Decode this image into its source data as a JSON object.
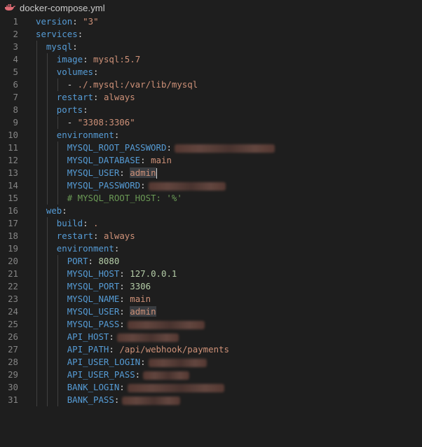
{
  "tab": {
    "title": "docker-compose.yml",
    "icon": "docker-whale-icon",
    "icon_color": "#e06c75"
  },
  "colors": {
    "background": "#1e1e1e",
    "line_number": "#858585",
    "key": "#569cd6",
    "string": "#ce9178",
    "number": "#b5cea8",
    "comment": "#6a9955"
  },
  "lines": [
    {
      "n": "1",
      "indent": 0,
      "key": "version",
      "value": "\"3\"",
      "vtype": "s"
    },
    {
      "n": "2",
      "indent": 0,
      "key": "services",
      "value": "",
      "vtype": ""
    },
    {
      "n": "3",
      "indent": 1,
      "key": "mysql",
      "value": "",
      "vtype": ""
    },
    {
      "n": "4",
      "indent": 2,
      "key": "image",
      "value": "mysql:5.7",
      "vtype": "s"
    },
    {
      "n": "5",
      "indent": 2,
      "key": "volumes",
      "value": "",
      "vtype": ""
    },
    {
      "n": "6",
      "indent": 3,
      "dash": true,
      "value": "./.mysql:/var/lib/mysql",
      "vtype": "s"
    },
    {
      "n": "7",
      "indent": 2,
      "key": "restart",
      "value": "always",
      "vtype": "s"
    },
    {
      "n": "8",
      "indent": 2,
      "key": "ports",
      "value": "",
      "vtype": ""
    },
    {
      "n": "9",
      "indent": 3,
      "dash": true,
      "value": "\"3308:3306\"",
      "vtype": "s"
    },
    {
      "n": "10",
      "indent": 2,
      "key": "environment",
      "value": "",
      "vtype": ""
    },
    {
      "n": "11",
      "indent": 3,
      "key": "MYSQL_ROOT_PASSWORD",
      "value": "",
      "vtype": "",
      "redacted": 0.26
    },
    {
      "n": "12",
      "indent": 3,
      "key": "MYSQL_DATABASE",
      "value": "main",
      "vtype": "s"
    },
    {
      "n": "13",
      "indent": 3,
      "key": "MYSQL_USER",
      "value": "admin",
      "vtype": "s",
      "selected": true,
      "cursor": true
    },
    {
      "n": "14",
      "indent": 3,
      "key": "MYSQL_PASSWORD",
      "value": "",
      "vtype": "",
      "redacted": 0.2
    },
    {
      "n": "15",
      "indent": 3,
      "comment": "# MYSQL_ROOT_HOST: '%'"
    },
    {
      "n": "16",
      "indent": 1,
      "key": "web",
      "value": "",
      "vtype": ""
    },
    {
      "n": "17",
      "indent": 2,
      "key": "build",
      "value": ".",
      "vtype": "s"
    },
    {
      "n": "18",
      "indent": 2,
      "key": "restart",
      "value": "always",
      "vtype": "s"
    },
    {
      "n": "19",
      "indent": 2,
      "key": "environment",
      "value": "",
      "vtype": ""
    },
    {
      "n": "20",
      "indent": 3,
      "key": "PORT",
      "value": "8080",
      "vtype": "n"
    },
    {
      "n": "21",
      "indent": 3,
      "key": "MYSQL_HOST",
      "value": "127.0.0.1",
      "vtype": "n"
    },
    {
      "n": "22",
      "indent": 3,
      "key": "MYSQL_PORT",
      "value": "3306",
      "vtype": "n"
    },
    {
      "n": "23",
      "indent": 3,
      "key": "MYSQL_NAME",
      "value": "main",
      "vtype": "s"
    },
    {
      "n": "24",
      "indent": 3,
      "key": "MYSQL_USER",
      "value": "admin",
      "vtype": "s",
      "selected": true
    },
    {
      "n": "25",
      "indent": 3,
      "key": "MYSQL_PASS",
      "value": "",
      "vtype": "",
      "redacted": 0.2
    },
    {
      "n": "26",
      "indent": 3,
      "key": "API_HOST",
      "value": "",
      "vtype": "",
      "redacted": 0.16
    },
    {
      "n": "27",
      "indent": 3,
      "key": "API_PATH",
      "value": "/api/webhook/payments",
      "vtype": "s"
    },
    {
      "n": "28",
      "indent": 3,
      "key": "API_USER_LOGIN",
      "value": "",
      "vtype": "",
      "redacted": 0.15
    },
    {
      "n": "29",
      "indent": 3,
      "key": "API_USER_PASS",
      "value": "",
      "vtype": "",
      "redacted": 0.12
    },
    {
      "n": "30",
      "indent": 3,
      "key": "BANK_LOGIN",
      "value": "",
      "vtype": "",
      "redacted": 0.25
    },
    {
      "n": "31",
      "indent": 3,
      "key": "BANK_PASS",
      "value": "",
      "vtype": "",
      "redacted": 0.15
    }
  ]
}
